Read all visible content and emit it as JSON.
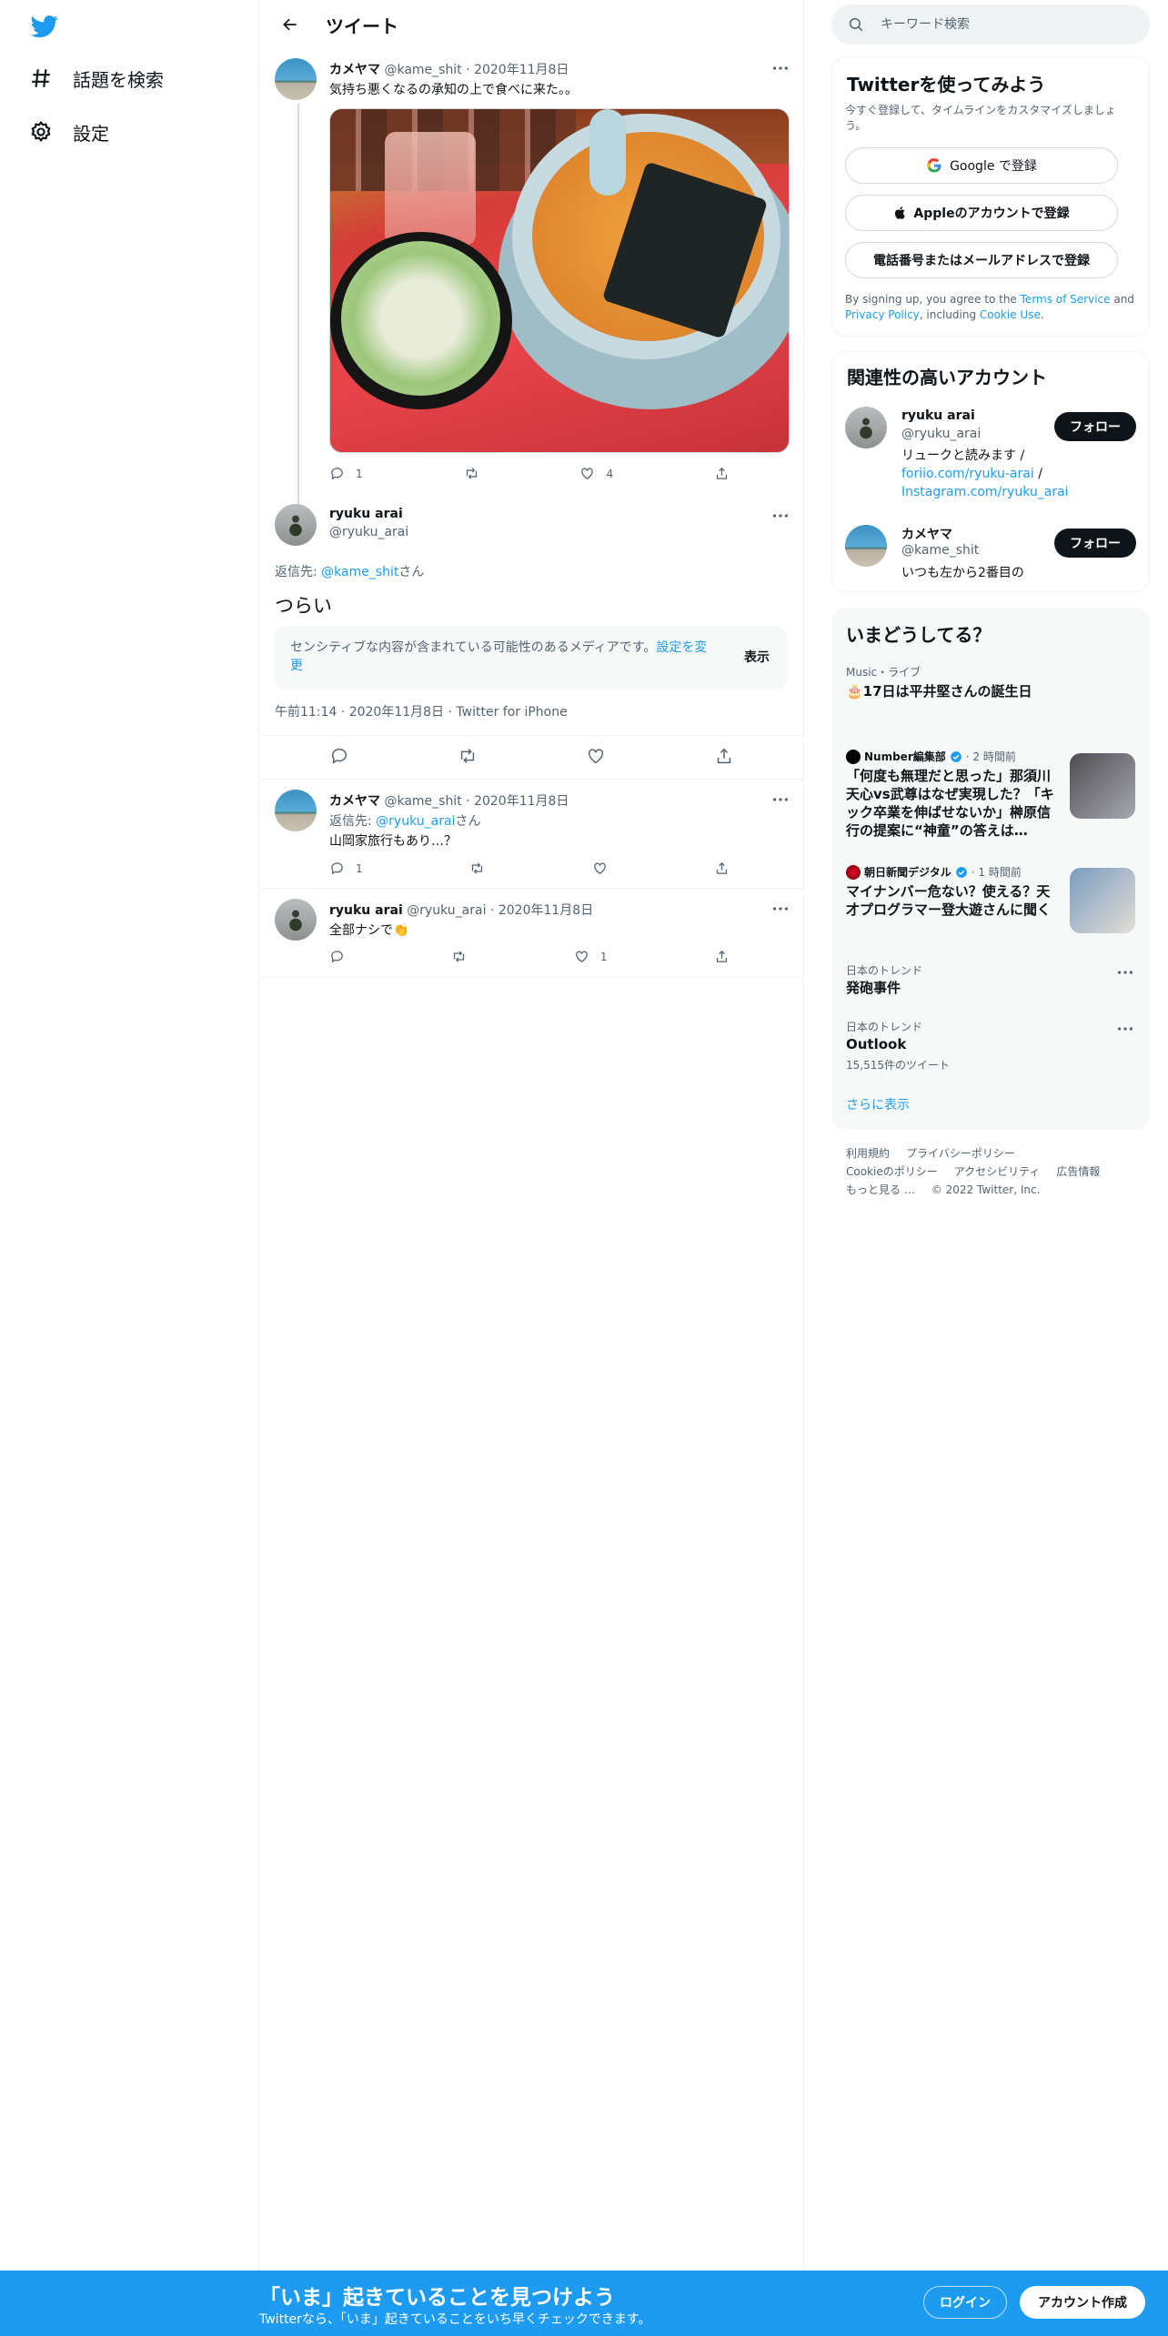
{
  "nav": {
    "logo": "twitter-bird-icon",
    "items": [
      {
        "label": "話題を検索",
        "icon": "hashtag-icon"
      },
      {
        "label": "設定",
        "icon": "gear-icon"
      }
    ]
  },
  "header": {
    "title": "ツイート"
  },
  "thread": {
    "parent": {
      "name": "カメヤマ",
      "handle": "@kame_shit",
      "sep": "·",
      "date": "2020年11月8日",
      "text": "気持ち悪くなるの承知の上で食べに来た。。",
      "reply_count": "1",
      "like_count": "4"
    },
    "main": {
      "name": "ryuku arai",
      "handle": "@ryuku_arai",
      "reply_prefix": "返信先: ",
      "reply_to": "@kame_shit",
      "reply_suffix": "さん",
      "text": "つらい",
      "sensitive_text": "センシティブな内容が含まれている可能性のあるメディアです。",
      "sensitive_link": "設定を変更",
      "show_label": "表示",
      "meta": "午前11:14 · 2020年11月8日 · Twitter for iPhone"
    },
    "reply1": {
      "name": "カメヤマ",
      "handle": "@kame_shit",
      "sep": "·",
      "date": "2020年11月8日",
      "reply_prefix": "返信先: ",
      "reply_to": "@ryuku_arai",
      "reply_suffix": "さん",
      "text": "山岡家旅行もあり…？",
      "reply_count": "1"
    },
    "reply2": {
      "name": "ryuku arai",
      "handle": "@ryuku_arai",
      "sep": "·",
      "date": "2020年11月8日",
      "text": "全部ナシで👏",
      "like_count": "1"
    }
  },
  "search": {
    "placeholder": "キーワード検索"
  },
  "signup_card": {
    "title": "Twitterを使ってみよう",
    "subtitle": "今すぐ登録して、タイムラインをカスタマイズしましょう。",
    "google": "Google で登録",
    "apple": "Appleのアカウントで登録",
    "phone": "電話番号またはメールアドレスで登録",
    "terms_prefix": "By signing up, you agree to the ",
    "terms_link": "Terms of Service",
    "and": " and ",
    "privacy_link": "Privacy Policy",
    "including": ", including ",
    "cookie_link": "Cookie Use",
    "period": "."
  },
  "related": {
    "title": "関連性の高いアカウント",
    "accounts": [
      {
        "name": "ryuku arai",
        "handle": "@ryuku_arai",
        "bio1": "リュークと読みます / ",
        "bio_link1": "foriio.com/ryuku-arai",
        "bio2": " / ",
        "bio_link2": "Instagram.com/ryuku_arai",
        "follow": "フォロー"
      },
      {
        "name": "カメヤマ",
        "handle": "@kame_shit",
        "bio": "いつも左から2番目の",
        "follow": "フォロー"
      }
    ]
  },
  "trends": {
    "title": "いまどうしてる？",
    "items": [
      {
        "meta": "Music・ライブ",
        "title": "🎂17日は平井堅さんの誕生日"
      },
      {
        "source": "Number編集部",
        "time": "· 2 時間前",
        "title": "「何度も無理だと思った」那須川天心vs武尊はなぜ実現した？「キック卒業を伸ばせないか」榊原信行の提案に“神童”の答えは…"
      },
      {
        "source": "朝日新聞デジタル",
        "time": "· 1 時間前",
        "title": "マイナンバー危ない？使える？天才プログラマー登大遊さんに聞く"
      },
      {
        "meta": "日本のトレンド",
        "title": "発砲事件"
      },
      {
        "meta": "日本のトレンド",
        "title": "Outlook",
        "count": "15,515件のツイート"
      }
    ],
    "more": "さらに表示"
  },
  "footer": {
    "links": [
      "利用規約",
      "プライバシーポリシー",
      "Cookieのポリシー",
      "アクセシビリティ",
      "広告情報",
      "もっと見る …"
    ],
    "copyright": "© 2022 Twitter, Inc."
  },
  "banner": {
    "title": "「いま」起きていることを見つけよう",
    "subtitle": "Twitterなら、「いま」起きていることをいち早くチェックできます。",
    "login": "ログイン",
    "signup": "アカウント作成"
  },
  "colors": {
    "accent": "#1d9bf0",
    "text": "#0f1419",
    "muted": "#536471"
  }
}
